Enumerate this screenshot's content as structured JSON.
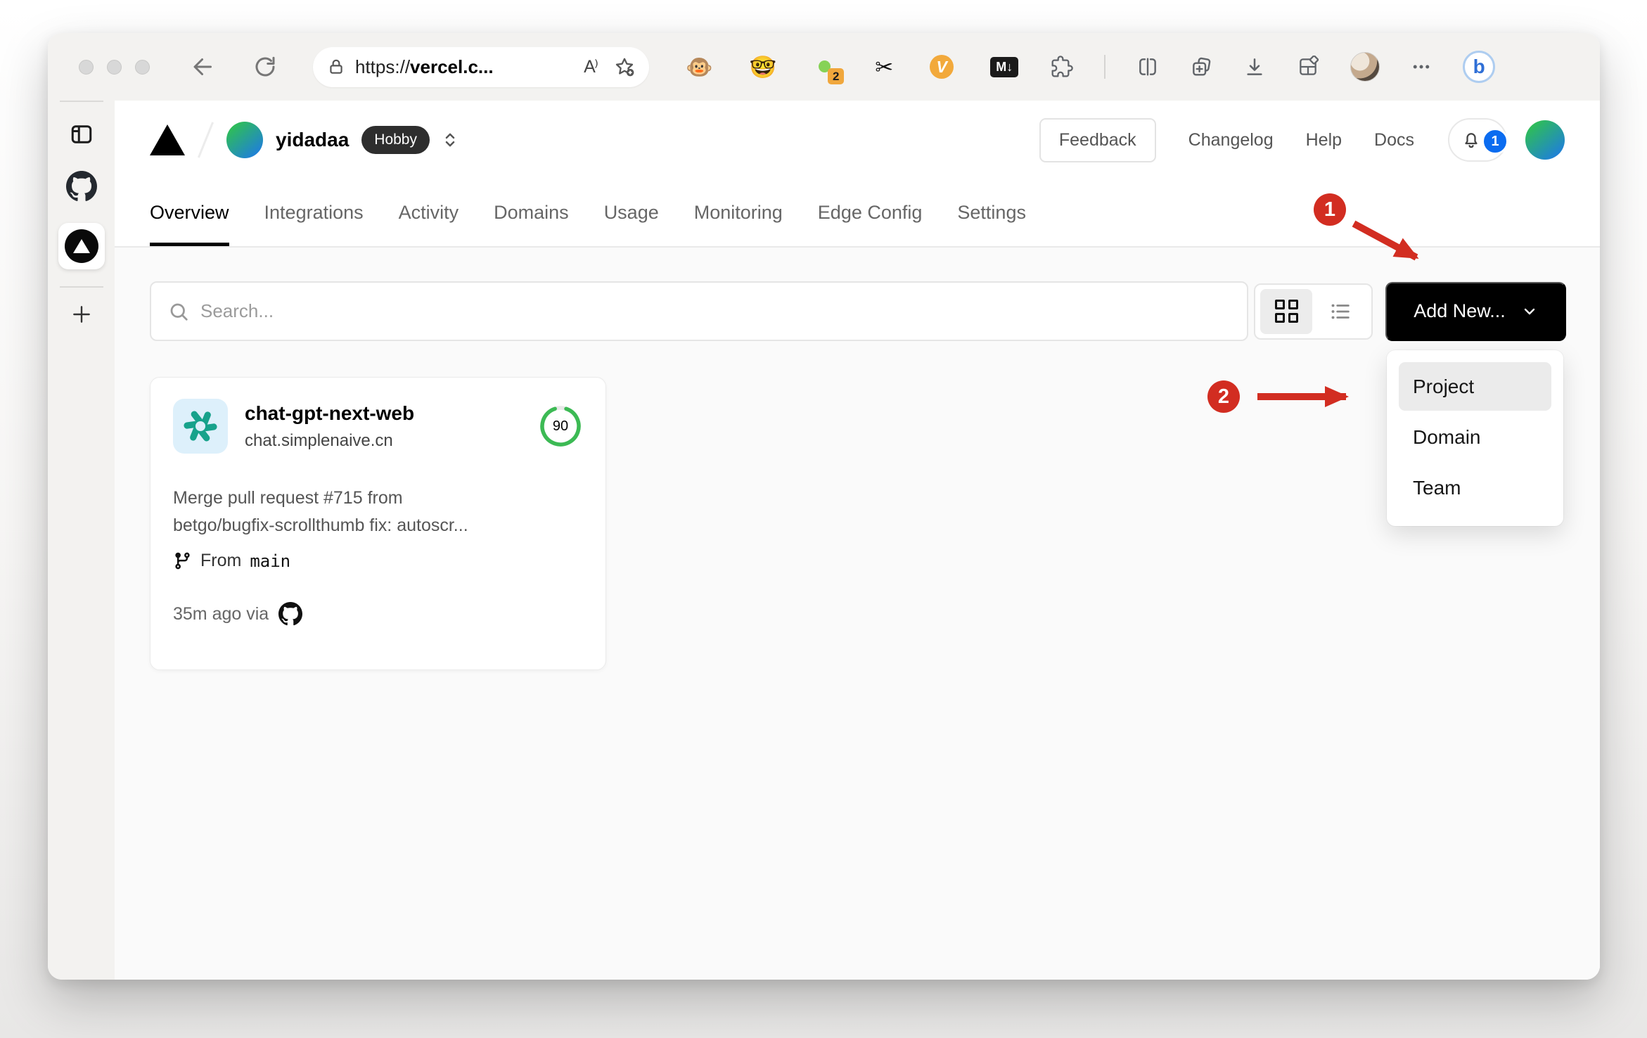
{
  "browser": {
    "url_scheme": "https://",
    "url_host": "vercel.c...",
    "read_aloud_label": "A⁾",
    "extensions_badge": "2",
    "v_icon_label": "V",
    "markdown_icon_label": "M↓",
    "bing_label": "b"
  },
  "vercel": {
    "team_name": "yidadaa",
    "plan_badge": "Hobby",
    "feedback_label": "Feedback",
    "nav_links": [
      "Changelog",
      "Help",
      "Docs"
    ],
    "notification_count": "1",
    "tabs": [
      "Overview",
      "Integrations",
      "Activity",
      "Domains",
      "Usage",
      "Monitoring",
      "Edge Config",
      "Settings"
    ],
    "active_tab": "Overview",
    "search_placeholder": "Search...",
    "add_new_label": "Add New...",
    "dropdown": {
      "items": [
        "Project",
        "Domain",
        "Team"
      ],
      "highlighted": "Project"
    },
    "project_card": {
      "name": "chat-gpt-next-web",
      "domain": "chat.simplenaive.cn",
      "score": "90",
      "commit_line1": "Merge pull request #715 from",
      "commit_line2": "betgo/bugfix-scrollthumb fix: autoscr...",
      "branch_prefix": "From",
      "branch_name": "main",
      "deployed": "35m ago via"
    }
  },
  "annotations": {
    "step1": "1",
    "step2": "2"
  },
  "colors": {
    "annotation_red": "#d22d21",
    "success_green": "#3cba54",
    "notification_blue": "#0b6cf0",
    "brand_black": "#000000"
  }
}
